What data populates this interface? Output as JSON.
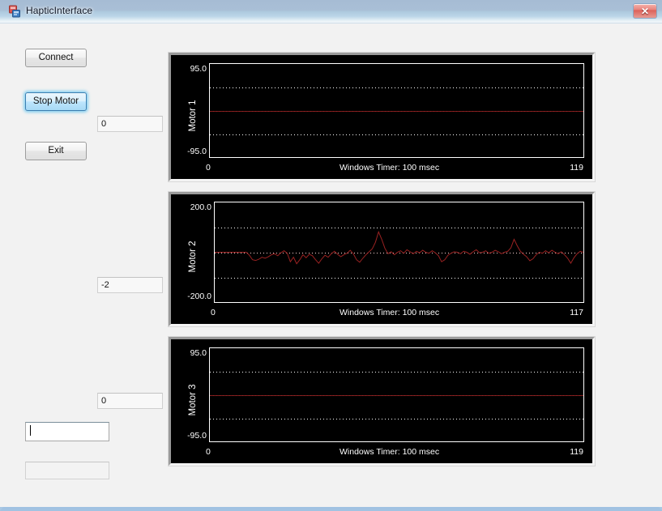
{
  "window": {
    "title": "HapticInterface",
    "icon": "app-icon",
    "close_label": "✕",
    "background": "#f2f2f2",
    "titlebar_accent": "#a6bcd4"
  },
  "controls": {
    "connect_label": "Connect",
    "stop_motor_label": "Stop Motor",
    "exit_label": "Exit",
    "motor1_value": "0",
    "motor2_value": "-2",
    "motor3_value": "0",
    "command_value": "",
    "command_placeholder": "",
    "status_value": "",
    "status_placeholder": ""
  },
  "chart_data": [
    {
      "type": "line",
      "title": "",
      "ylabel": "Motor 1",
      "xlabel": "Windows Timer: 100 msec",
      "ylim": [
        -95.0,
        95.0
      ],
      "ytick_labels": [
        "95.0",
        "-95.0"
      ],
      "xlim": [
        0,
        119
      ],
      "xtick_labels": [
        "0",
        "119"
      ],
      "grid": true,
      "gridline_values": [
        47.5,
        0,
        -47.5
      ],
      "series": [
        {
          "name": "Motor 1",
          "color": "#9b2222",
          "x": [
            0,
            119
          ],
          "values": [
            0,
            0
          ]
        }
      ]
    },
    {
      "type": "line",
      "title": "",
      "ylabel": "Motor 2",
      "xlabel": "Windows Timer: 100 msec",
      "ylim": [
        -200.0,
        200.0
      ],
      "ytick_labels": [
        "200.0",
        "-200.0"
      ],
      "xlim": [
        0,
        117
      ],
      "xtick_labels": [
        "0",
        "117"
      ],
      "grid": true,
      "gridline_values": [
        100,
        0,
        -100
      ],
      "series": [
        {
          "name": "Motor 2",
          "color": "#9b2222",
          "x": [
            0,
            1,
            2,
            3,
            4,
            5,
            6,
            7,
            8,
            9,
            10,
            11,
            12,
            13,
            14,
            15,
            16,
            17,
            18,
            19,
            20,
            21,
            22,
            23,
            24,
            25,
            26,
            27,
            28,
            29,
            30,
            31,
            32,
            33,
            34,
            35,
            36,
            37,
            38,
            39,
            40,
            41,
            42,
            43,
            44,
            45,
            46,
            47,
            48,
            49,
            50,
            51,
            52,
            53,
            54,
            55,
            56,
            57,
            58,
            59,
            60,
            61,
            62,
            63,
            64,
            65,
            66,
            67,
            68,
            69,
            70,
            71,
            72,
            73,
            74,
            75,
            76,
            77,
            78,
            79,
            80,
            81,
            82,
            83,
            84,
            85,
            86,
            87,
            88,
            89,
            90,
            91,
            92,
            93,
            94,
            95,
            96,
            97,
            98,
            99,
            100,
            101,
            102,
            103,
            104,
            105,
            106,
            107,
            108,
            109,
            110,
            111,
            112,
            113,
            114,
            115,
            116,
            117
          ],
          "values": [
            0,
            0,
            0,
            0,
            0,
            0,
            0,
            0,
            0,
            0,
            0,
            -12,
            -30,
            -33,
            -28,
            -20,
            -24,
            -18,
            -10,
            -6,
            -14,
            -2,
            6,
            -4,
            -38,
            -20,
            -46,
            -30,
            -10,
            -22,
            -8,
            -14,
            -30,
            -44,
            -26,
            -12,
            -20,
            -6,
            4,
            -8,
            -18,
            -10,
            -4,
            8,
            -6,
            -30,
            -40,
            -24,
            -10,
            2,
            14,
            40,
            82,
            52,
            16,
            -6,
            2,
            -10,
            0,
            6,
            -4,
            10,
            2,
            -6,
            4,
            -2,
            8,
            0,
            -4,
            6,
            -2,
            -14,
            -38,
            -30,
            -12,
            -4,
            2,
            0,
            -6,
            4,
            0,
            -8,
            2,
            10,
            -2,
            0,
            6,
            -4,
            0,
            8,
            2,
            -6,
            0,
            4,
            18,
            52,
            26,
            4,
            -8,
            -18,
            -34,
            -26,
            -10,
            0,
            -4,
            6,
            -2,
            8,
            0,
            -6,
            2,
            -10,
            -24,
            -44,
            -22,
            -6,
            4,
            0
          ]
        }
      ]
    },
    {
      "type": "line",
      "title": "",
      "ylabel": "Motor 3",
      "xlabel": "Windows Timer: 100 msec",
      "ylim": [
        -95.0,
        95.0
      ],
      "ytick_labels": [
        "95.0",
        "-95.0"
      ],
      "xlim": [
        0,
        119
      ],
      "xtick_labels": [
        "0",
        "119"
      ],
      "grid": true,
      "gridline_values": [
        47.5,
        0,
        -47.5
      ],
      "series": [
        {
          "name": "Motor 3",
          "color": "#9b2222",
          "x": [
            0,
            119
          ],
          "values": [
            0,
            0
          ]
        }
      ]
    }
  ]
}
